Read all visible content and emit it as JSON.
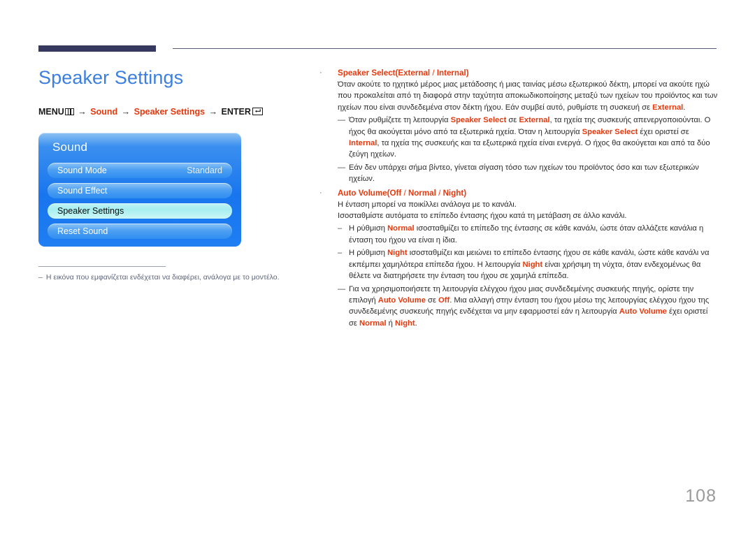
{
  "header": {
    "accent_color": "#36385f",
    "rule_color": "#585a7c"
  },
  "page": {
    "title": "Speaker Settings",
    "title_color": "#3b7fe0",
    "number": "108"
  },
  "menu_path": {
    "menu_label": "MENU",
    "menu_icon": "menu-grid-icon",
    "arrow": "→",
    "step1": "Sound",
    "step2": "Speaker Settings",
    "enter_label": "ENTER",
    "enter_icon": "enter-return-icon",
    "accent_color": "#e8380d"
  },
  "osd": {
    "title": "Sound",
    "rows": [
      {
        "label": "Sound Mode",
        "value": "Standard",
        "selected": false
      },
      {
        "label": "Sound Effect",
        "value": "",
        "selected": false
      },
      {
        "label": "Speaker Settings",
        "value": "",
        "selected": true
      },
      {
        "label": "Reset Sound",
        "value": "",
        "selected": false
      }
    ]
  },
  "footnote": {
    "dash": "–",
    "text": "Η εικόνα που εμφανίζεται ενδέχεται να διαφέρει, ανάλογα με το μοντέλο."
  },
  "content": {
    "bullet_glyph": "·",
    "dash_glyph": "―",
    "small_dash_glyph": "–",
    "speaker_select": {
      "title": "Speaker Select",
      "options_open": "(",
      "option1": "External",
      "option_sep": " / ",
      "option2": "Internal",
      "options_close": ")",
      "paragraph_a": "Όταν ακούτε το ηχητικό μέρος μιας μετάδοσης ή μιας ταινίας μέσω εξωτερικού δέκτη, μπορεί να ακούτε ηχώ που προκαλείται από τη διαφορά στην ταχύτητα αποκωδικοποίησης μεταξύ των ηχείων του προϊόντος και των ηχείων που είναι συνδεδεμένα στον δέκτη ήχου. Εάν συμβεί αυτό, ρυθμίστε τη συσκευή σε ",
      "paragraph_a_tail_kw": "External",
      "paragraph_a_tail": ".",
      "note1_p1": "Όταν ρυθμίζετε τη λειτουργία ",
      "note1_kw1": "Speaker Select",
      "note1_p2": " σε ",
      "note1_kw2": "External",
      "note1_p3": ", τα ηχεία της συσκευής απενεργοποιούνται. Ο ήχος θα ακούγεται μόνο από τα εξωτερικά ηχεία. Όταν η λειτουργία ",
      "note1_kw3": "Speaker Select",
      "note1_p4": " έχει οριστεί σε ",
      "note1_kw4": "Internal",
      "note1_p5": ", τα ηχεία της συσκευής και τα εξωτερικά ηχεία είναι ενεργά. Ο ήχος θα ακούγεται και από τα δύο ζεύγη ηχείων.",
      "note2": "Εάν δεν υπάρχει σήμα βίντεο, γίνεται σίγαση τόσο των ηχείων του προϊόντος όσο και των εξωτερικών ηχείων."
    },
    "auto_volume": {
      "title": "Auto Volume",
      "options_open": "(",
      "option1": "Off",
      "option2": "Normal",
      "option3": "Night",
      "options_close": ")",
      "option_sep": " / ",
      "line1": "Η ένταση μπορεί να ποικίλλει ανάλογα με το κανάλι.",
      "line2": "Ισοσταθμίστε αυτόματα το επίπεδο έντασης ήχου κατά τη μετάβαση σε άλλο κανάλι.",
      "sub1_p1": "Η ρύθμιση ",
      "sub1_kw": "Normal",
      "sub1_p2": " ισοσταθμίζει το επίπεδο της έντασης σε κάθε κανάλι, ώστε όταν αλλάζετε κανάλια η ένταση του ήχου να είναι η ίδια.",
      "sub2_p1": "Η ρύθμιση ",
      "sub2_kw1": "Night",
      "sub2_p2": " ισοσταθμίζει και μειώνει το επίπεδο έντασης ήχου σε κάθε κανάλι, ώστε κάθε κανάλι να εκπέμπει χαμηλότερα επίπεδα ήχου. Η λειτουργία ",
      "sub2_kw2": "Night",
      "sub2_p3": " είναι χρήσιμη τη νύχτα, όταν ενδεχομένως θα θέλετε να διατηρήσετε την ένταση του ήχου σε χαμηλά επίπεδα.",
      "note_p1": "Για να χρησιμοποιήσετε τη λειτουργία ελέγχου ήχου μιας συνδεδεμένης συσκευής πηγής, ορίστε την επιλογή ",
      "note_kw1": "Auto Volume",
      "note_p2": " σε ",
      "note_kw2": "Off",
      "note_p3": ". Μια αλλαγή στην ένταση του ήχου μέσω της λειτουργίας ελέγχου ήχου της συνδεδεμένης συσκευής πηγής ενδέχεται να μην εφαρμοστεί εάν η λειτουργία ",
      "note_kw3": "Auto Volume",
      "note_p4": " έχει οριστεί σε ",
      "note_kw4": "Normal",
      "note_p5": " ή ",
      "note_kw5": "Night",
      "note_p6": "."
    }
  }
}
